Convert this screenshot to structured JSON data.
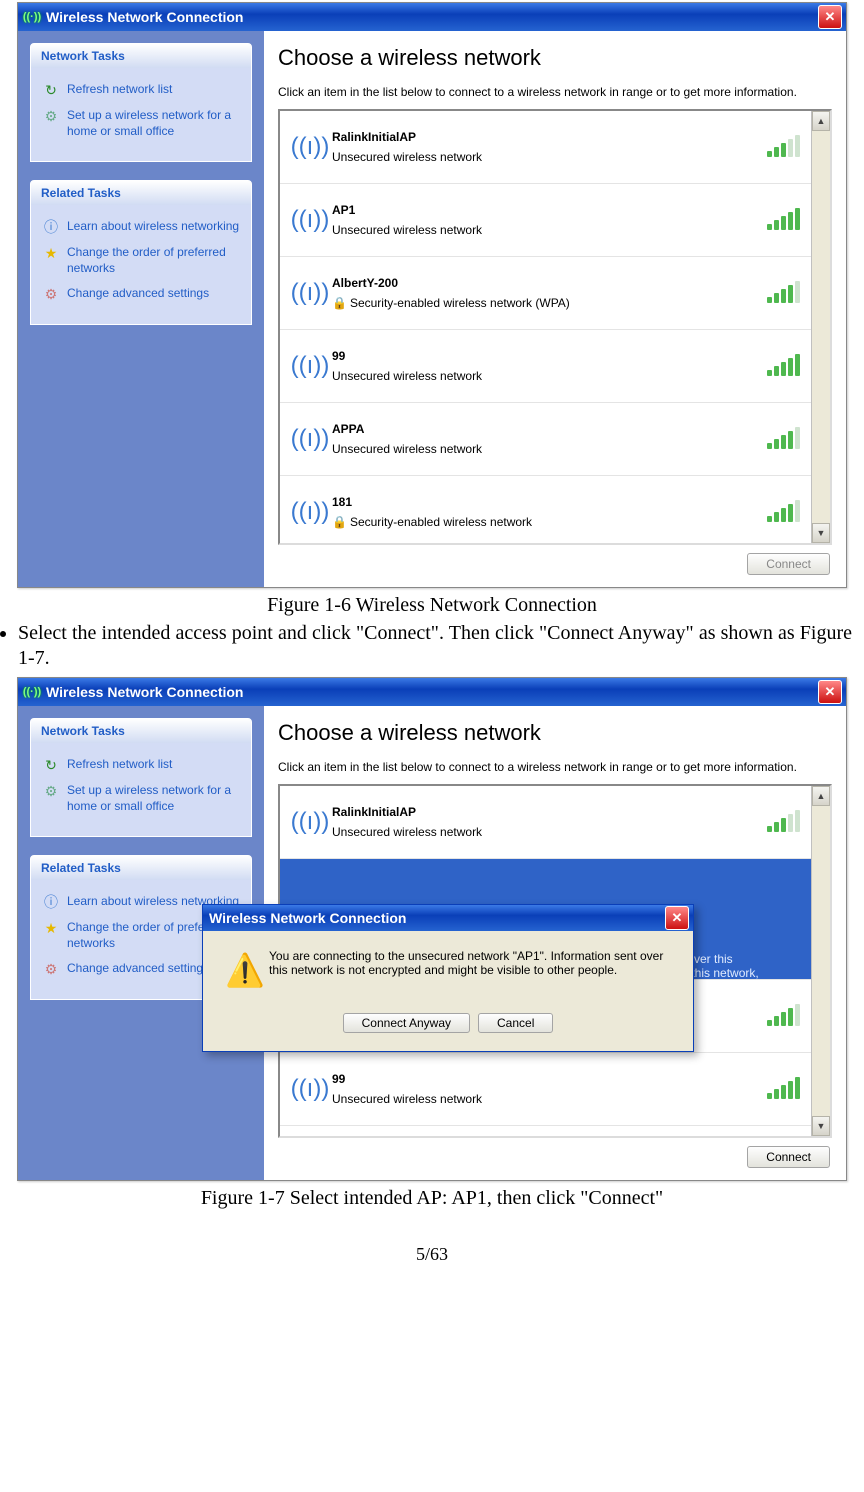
{
  "window_title": "Wireless Network Connection",
  "heading": "Choose a wireless network",
  "instruction": "Click an item in the list below to connect to a wireless network in range or to get more information.",
  "sidebar": {
    "network_tasks": {
      "title": "Network Tasks",
      "refresh": "Refresh network list",
      "setup": "Set up a wireless network for a home or small office"
    },
    "related_tasks": {
      "title": "Related Tasks",
      "learn": "Learn about wireless networking",
      "order": "Change the order of preferred networks",
      "advanced": "Change advanced settings"
    }
  },
  "sec_unsecured": "Unsecured wireless network",
  "sec_wpa": "Security-enabled wireless network (WPA)",
  "sec_enabled": "Security-enabled wireless network",
  "networks": {
    "n0": "RalinkInitialAP",
    "n1": "AP1",
    "n2": "AlbertY-200",
    "n3": "99",
    "n4": "APPA",
    "n5": "181"
  },
  "connect_btn_disabled": "Connect",
  "connect_btn_enabled": "Connect",
  "caption1": "Figure 1-6 Wireless Network Connection",
  "bullet1": "Select the intended access point and click \"Connect\". Then click \"Connect Anyway\" as shown as Figure 1-7.",
  "caption2": "Figure 1-7 Select intended AP: AP1, then click \"Connect\"",
  "dialog": {
    "title": "Wireless Network Connection",
    "text": "You are connecting to the unsecured network \"AP1\". Information sent over this network is not encrypted and might be visible to other people.",
    "connect_anyway": "Connect Anyway",
    "cancel": "Cancel"
  },
  "sel_hint_right": "it over this\nto this network,",
  "page_number": "5/63"
}
